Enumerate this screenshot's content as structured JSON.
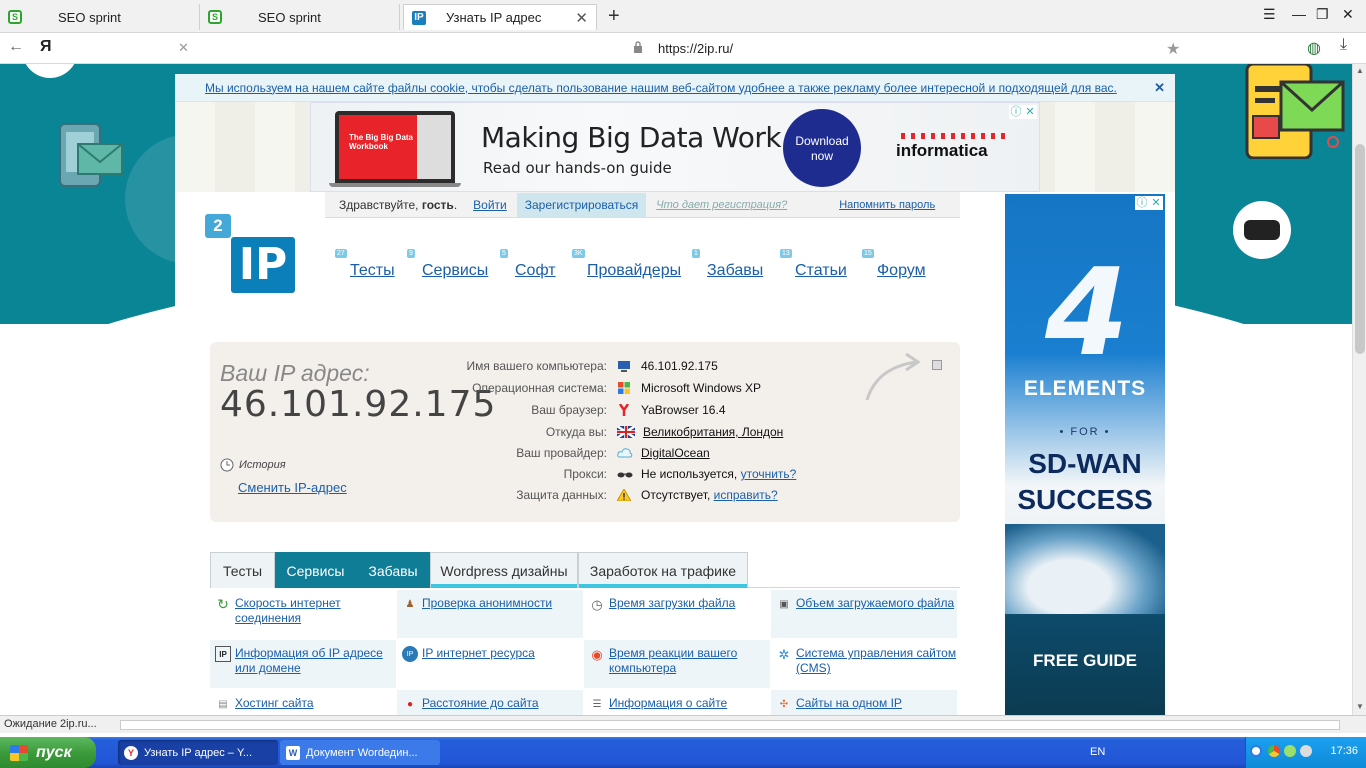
{
  "browser": {
    "tabs": [
      {
        "title": "SEO sprint",
        "favicon": "seosprint-icon",
        "active": false
      },
      {
        "title": "SEO sprint",
        "favicon": "seosprint-icon",
        "active": false
      },
      {
        "title": "Узнать IP адрес",
        "favicon": "2ip-icon",
        "active": true
      }
    ],
    "url": "https://2ip.ru/",
    "status_text": "Ожидание 2ip.ru..."
  },
  "cookie_notice": {
    "text": "Мы используем на нашем сайте файлы cookie, чтобы сделать пользование нашим веб-сайтом удобнее а также рекламу более интересной и подходящей для вас."
  },
  "ad_top": {
    "screen_title": "The Big Big Data Workbook",
    "headline": "Making Big Data Work",
    "subline": "Read our hands-on guide",
    "button": "Download now",
    "brand": "informatica"
  },
  "login_bar": {
    "greeting": "Здравствуйте, ",
    "guest": "гость",
    "login": "Войти",
    "register": "Зарегистрироваться",
    "why": "Что дает регистрация?",
    "remind": "Напомнить пароль"
  },
  "logo": {
    "top": "2",
    "main": "IP"
  },
  "nav": [
    {
      "label": "Тесты",
      "count": "27"
    },
    {
      "label": "Сервисы",
      "count": "9"
    },
    {
      "label": "Софт",
      "count": "5"
    },
    {
      "label": "Провайдеры",
      "count": "3K"
    },
    {
      "label": "Забавы",
      "count": "1"
    },
    {
      "label": "Статьи",
      "count": "13"
    },
    {
      "label": "Форум",
      "count": "15"
    }
  ],
  "ip_box": {
    "label": "Ваш IP адрес:",
    "ip": "46.101.92.175",
    "history": "История",
    "change": "Сменить IP-адрес",
    "rows": [
      {
        "key": "Имя вашего компьютера:",
        "value": "46.101.92.175",
        "link": "",
        "icon": "computer-icon"
      },
      {
        "key": "Операционная система:",
        "value": "Microsoft Windows XP",
        "link": "",
        "icon": "windows-icon"
      },
      {
        "key": "Ваш браузер:",
        "value": "YaBrowser 16.4",
        "link": "",
        "icon": "yandex-browser-icon"
      },
      {
        "key": "Откуда вы:",
        "value": "",
        "link": "Великобритания, Лондон",
        "icon": "uk-flag-icon"
      },
      {
        "key": "Ваш провайдер:",
        "value": "",
        "link": "DigitalOcean",
        "icon": "cloud-icon"
      },
      {
        "key": "Прокси:",
        "value": "Не используется, ",
        "link": "уточнить?",
        "icon": "glasses-icon"
      },
      {
        "key": "Защита данных:",
        "value": "Отсутствует, ",
        "link": "исправить?",
        "icon": "warning-icon"
      }
    ]
  },
  "tabs": [
    {
      "label": "Тесты",
      "style": "light"
    },
    {
      "label": "Сервисы",
      "style": "dark"
    },
    {
      "label": "Забавы",
      "style": "dark"
    },
    {
      "label": "Wordpress дизайны",
      "style": "light"
    },
    {
      "label": "Заработок на трафике",
      "style": "light"
    }
  ],
  "services": [
    {
      "label": "Скорость интернет соединения",
      "icon": "speed-icon"
    },
    {
      "label": "Проверка анонимности",
      "icon": "anonymity-icon"
    },
    {
      "label": "Время загрузки файла",
      "icon": "clock-icon"
    },
    {
      "label": "Объем загружаемого файла",
      "icon": "file-size-icon"
    },
    {
      "label": "Информация об IP адресе или домене",
      "icon": "ip-info-icon"
    },
    {
      "label": "IP интернет ресурса",
      "icon": "ip-resource-icon"
    },
    {
      "label": "Время реакции вашего компьютера",
      "icon": "reaction-icon"
    },
    {
      "label": "Система управления сайтом (CMS)",
      "icon": "cms-icon"
    },
    {
      "label": "Хостинг сайта",
      "icon": "hosting-icon"
    },
    {
      "label": "Расстояние до сайта",
      "icon": "pin-icon"
    },
    {
      "label": "Информация о сайте",
      "icon": "site-info-icon"
    },
    {
      "label": "Сайты на одном IP",
      "icon": "same-ip-icon"
    }
  ],
  "ad_right": {
    "number": "4",
    "title": "ELEMENTS",
    "for": "• FOR •",
    "line1": "SD-WAN",
    "line2": "SUCCESS",
    "cta": "FREE GUIDE"
  },
  "taskbar": {
    "start": "пуск",
    "tasks": [
      {
        "label": "Узнать IP адрес – Y...",
        "active": true
      },
      {
        "label": "Документ Wordедин...",
        "active": false
      }
    ],
    "lang": "EN",
    "clock": "17:36"
  }
}
